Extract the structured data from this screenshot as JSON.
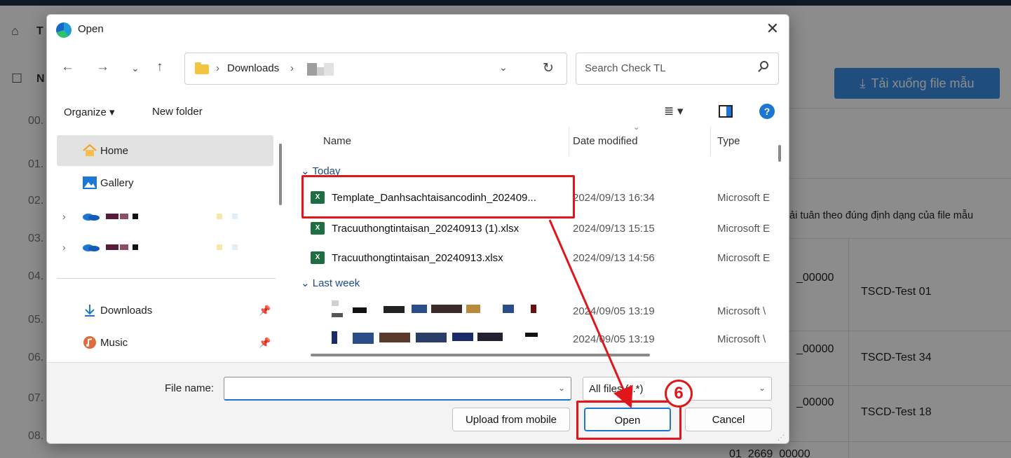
{
  "background_app": {
    "download_template_label": "Tải xuống file mẫu",
    "notice_text": "ải tuân theo đúng định dạng của file mẫu",
    "row_numbers": [
      "00.",
      "01.",
      "02.",
      "03.",
      "04.",
      "05.",
      "06.",
      "07.",
      "08."
    ],
    "header_letters": [
      "T",
      "N"
    ],
    "table": [
      {
        "code": "_00000",
        "name": "TSCD-Test 01"
      },
      {
        "code": "_00000",
        "name": "TSCD-Test 34"
      },
      {
        "code": "_00000",
        "name": "TSCD-Test 18"
      },
      {
        "code": "01_2669_00000",
        "name": ""
      }
    ]
  },
  "dialog": {
    "title": "Open",
    "address": {
      "crumbs": [
        "Downloads"
      ]
    },
    "search_placeholder": "Search Check TL",
    "commands": {
      "organize": "Organize ▾",
      "new_folder": "New folder"
    },
    "nav_pane": {
      "items": [
        {
          "label": "Home",
          "selected": true,
          "icon": "home-icon"
        },
        {
          "label": "Gallery",
          "icon": "gallery-icon"
        },
        {
          "label": "",
          "icon": "onedrive-icon",
          "expandable": true
        },
        {
          "label": "",
          "icon": "onedrive-icon",
          "expandable": true
        },
        {
          "label": "Downloads",
          "icon": "download-icon",
          "pinned": true
        },
        {
          "label": "Music",
          "icon": "music-icon",
          "pinned": true
        }
      ]
    },
    "file_list": {
      "columns": {
        "name": "Name",
        "date": "Date modified",
        "type": "Type"
      },
      "groups": [
        {
          "label": "Today",
          "files": [
            {
              "name": "Template_Danhsachtaisancodinh_202409...",
              "date": "2024/09/13 16:34",
              "type": "Microsoft E"
            },
            {
              "name": "Tracuuthongtintaisan_20240913 (1).xlsx",
              "date": "2024/09/13 15:15",
              "type": "Microsoft E"
            },
            {
              "name": "Tracuuthongtintaisan_20240913.xlsx",
              "date": "2024/09/13 14:56",
              "type": "Microsoft E"
            }
          ]
        },
        {
          "label": "Last week",
          "files": [
            {
              "name": "",
              "date": "2024/09/05 13:19",
              "type": "Microsoft \\"
            },
            {
              "name": "",
              "date": "2024/09/05 13:19",
              "type": "Microsoft \\"
            }
          ]
        }
      ]
    },
    "footer": {
      "file_name_label": "File name:",
      "file_name_value": "",
      "filter": "All files (*.*)",
      "upload_label": "Upload from mobile",
      "open_label": "Open",
      "cancel_label": "Cancel"
    }
  },
  "annotation": {
    "step": "6",
    "color": "#e0161b"
  },
  "colors": {
    "accent": "#1c76d2",
    "excel": "#1d6f42",
    "download_button": "#3a8ee6"
  }
}
